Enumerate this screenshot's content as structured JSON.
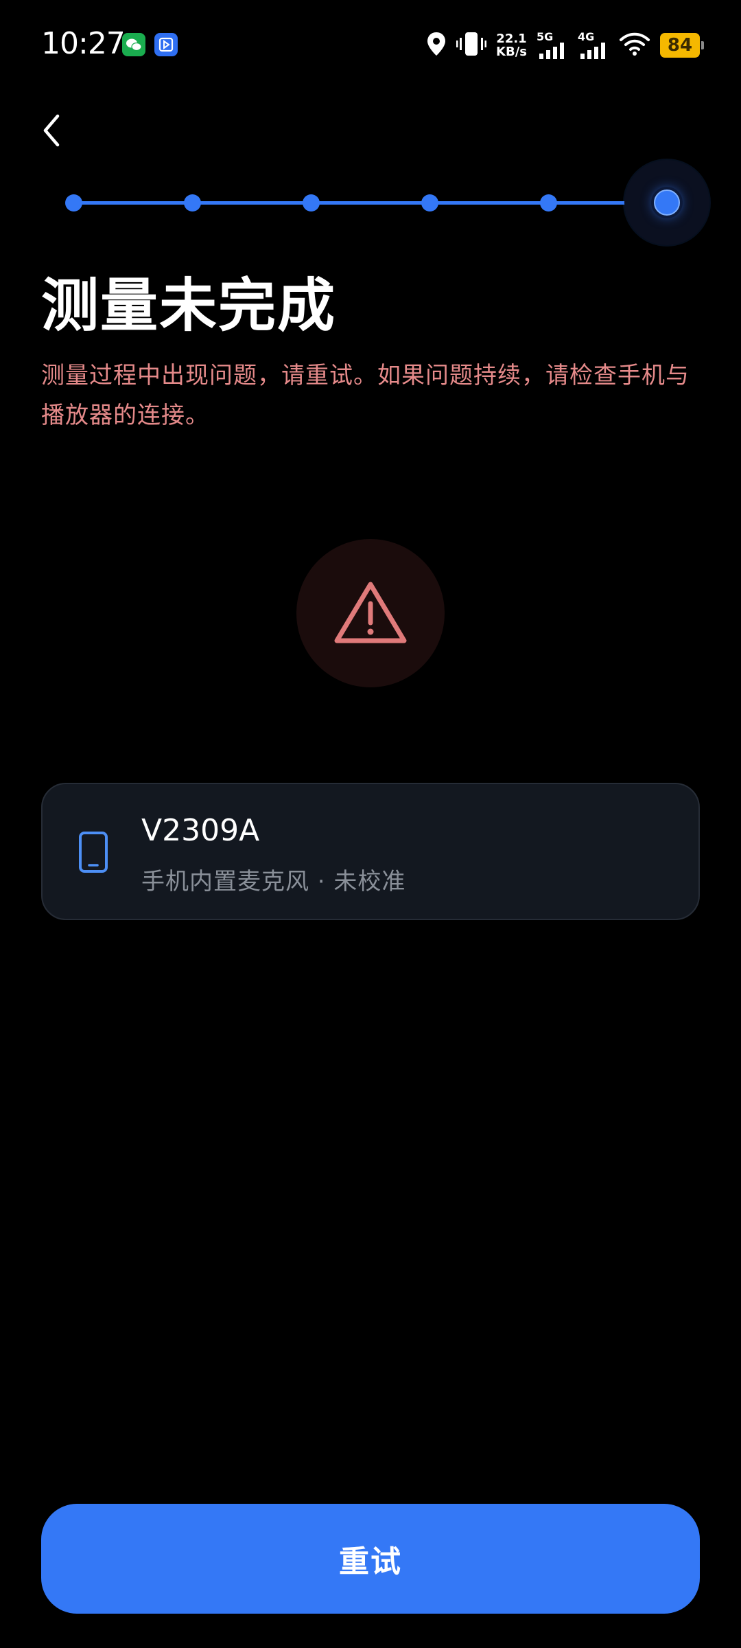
{
  "status_bar": {
    "time": "10:27",
    "net_speed_value": "22.1",
    "net_speed_unit": "KB/s",
    "signal_1_label": "5G",
    "signal_2_label": "4G",
    "battery": "84",
    "icons": [
      "wechat-icon",
      "app-icon",
      "location-icon",
      "vibrate-icon",
      "signal-icon",
      "wifi-icon",
      "battery-icon"
    ]
  },
  "header": {
    "back_icon": "chevron-left-icon"
  },
  "stepper": {
    "total_steps": 6,
    "current_step": 6
  },
  "main": {
    "title": "测量未完成",
    "message": "测量过程中出现问题，请重试。如果问题持续，请检查手机与播放器的连接。",
    "warning_icon": "warning-triangle-icon"
  },
  "device": {
    "icon": "phone-icon",
    "name": "V2309A",
    "status": "手机内置麦克风 · 未校准"
  },
  "actions": {
    "retry_label": "重试"
  },
  "colors": {
    "accent": "#3478f6",
    "error_text": "#e58a8a",
    "warning_icon": "#e07a7a",
    "battery": "#f5b800",
    "card_bg": "#131820"
  }
}
